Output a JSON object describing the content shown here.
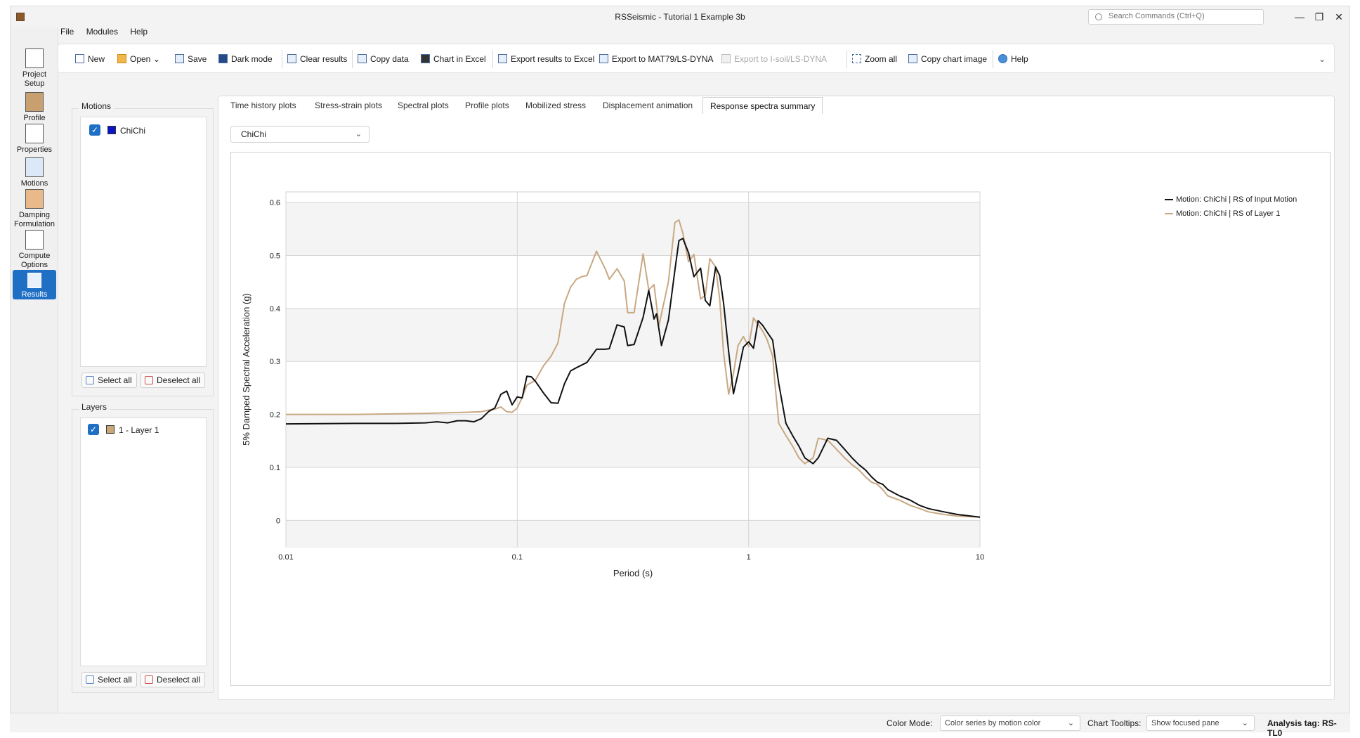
{
  "window": {
    "title": "RSSeismic - Tutorial 1 Example 3b",
    "search_placeholder": "Search Commands (Ctrl+Q)"
  },
  "menu": [
    "File",
    "Modules",
    "Help"
  ],
  "rail": [
    {
      "label": "Project Setup",
      "icon": "project-setup-icon"
    },
    {
      "label": "Profile",
      "icon": "profile-icon"
    },
    {
      "label": "Properties",
      "icon": "properties-icon"
    },
    {
      "label": "Motions",
      "icon": "motions-icon"
    },
    {
      "label": "Damping Formulation",
      "icon": "damping-icon"
    },
    {
      "label": "Compute Options",
      "icon": "compute-icon"
    },
    {
      "label": "Results",
      "icon": "results-icon",
      "active": true
    }
  ],
  "toolbar": {
    "new": "New",
    "open": "Open",
    "save": "Save",
    "dark_mode": "Dark mode",
    "clear_results": "Clear results",
    "copy_data": "Copy data",
    "chart_in_excel": "Chart in Excel",
    "export_results_excel": "Export results to Excel",
    "export_mat79": "Export to MAT79/LS-DYNA",
    "export_isoil": "Export to I-soil/LS-DYNA",
    "zoom_all": "Zoom all",
    "copy_chart_image": "Copy chart image",
    "help": "Help"
  },
  "motions_panel": {
    "title": "Motions",
    "items": [
      {
        "label": "ChiChi",
        "color": "#0a14c8",
        "checked": true
      }
    ],
    "select_all": "Select all",
    "deselect_all": "Deselect all"
  },
  "layers_panel": {
    "title": "Layers",
    "items": [
      {
        "label": "1 - Layer 1",
        "color": "#c8a878",
        "checked": true
      }
    ],
    "select_all": "Select all",
    "deselect_all": "Deselect all"
  },
  "tabs": [
    "Time history plots",
    "Stress-strain plots",
    "Spectral plots",
    "Profile plots",
    "Mobilized stress",
    "Displacement animation",
    "Response spectra summary"
  ],
  "active_tab": "Response spectra summary",
  "motion_select": "ChiChi",
  "chart_data": {
    "type": "line",
    "xlabel": "Period (s)",
    "ylabel": "5% Damped Spectral Acceleration (g)",
    "x_scale": "log",
    "xlim": [
      0.01,
      10
    ],
    "ylim": [
      -0.05,
      0.62
    ],
    "x_ticks": [
      "0.01",
      "0.1",
      "1",
      "10"
    ],
    "y_ticks": [
      "0",
      "0.1",
      "0.2",
      "0.3",
      "0.4",
      "0.5",
      "0.6"
    ],
    "legend_position": "right",
    "series": [
      {
        "name": "Motion: ChiChi | RS of Input Motion",
        "color": "#111111",
        "x": [
          0.01,
          0.02,
          0.03,
          0.04,
          0.045,
          0.05,
          0.055,
          0.06,
          0.065,
          0.07,
          0.075,
          0.08,
          0.085,
          0.09,
          0.095,
          0.1,
          0.105,
          0.11,
          0.115,
          0.12,
          0.13,
          0.14,
          0.15,
          0.16,
          0.17,
          0.18,
          0.2,
          0.22,
          0.24,
          0.25,
          0.27,
          0.29,
          0.3,
          0.32,
          0.35,
          0.37,
          0.39,
          0.4,
          0.42,
          0.45,
          0.48,
          0.5,
          0.52,
          0.55,
          0.58,
          0.62,
          0.65,
          0.68,
          0.72,
          0.75,
          0.78,
          0.82,
          0.86,
          0.9,
          0.95,
          1.0,
          1.05,
          1.1,
          1.15,
          1.2,
          1.27,
          1.3,
          1.35,
          1.45,
          1.55,
          1.65,
          1.75,
          1.9,
          2.0,
          2.2,
          2.4,
          2.6,
          2.8,
          3.0,
          3.2,
          3.4,
          3.6,
          3.8,
          4.0,
          4.5,
          5.0,
          5.5,
          6.0,
          7.0,
          8.0,
          10.0
        ],
        "y": [
          0.182,
          0.183,
          0.183,
          0.184,
          0.186,
          0.184,
          0.188,
          0.188,
          0.186,
          0.192,
          0.205,
          0.212,
          0.238,
          0.244,
          0.218,
          0.233,
          0.231,
          0.272,
          0.271,
          0.262,
          0.24,
          0.222,
          0.221,
          0.258,
          0.282,
          0.288,
          0.298,
          0.323,
          0.323,
          0.324,
          0.369,
          0.365,
          0.33,
          0.332,
          0.383,
          0.434,
          0.38,
          0.39,
          0.33,
          0.378,
          0.472,
          0.528,
          0.532,
          0.505,
          0.46,
          0.476,
          0.415,
          0.405,
          0.478,
          0.462,
          0.409,
          0.318,
          0.239,
          0.277,
          0.327,
          0.337,
          0.325,
          0.377,
          0.368,
          0.356,
          0.34,
          0.308,
          0.258,
          0.183,
          0.16,
          0.14,
          0.118,
          0.107,
          0.118,
          0.155,
          0.151,
          0.134,
          0.118,
          0.105,
          0.095,
          0.082,
          0.072,
          0.068,
          0.058,
          0.046,
          0.038,
          0.028,
          0.022,
          0.016,
          0.011,
          0.006
        ]
      },
      {
        "name": "Motion: ChiChi | RS of Layer 1",
        "color": "#c8a882",
        "x": [
          0.01,
          0.02,
          0.03,
          0.04,
          0.05,
          0.06,
          0.07,
          0.075,
          0.08,
          0.085,
          0.09,
          0.095,
          0.1,
          0.105,
          0.11,
          0.12,
          0.13,
          0.14,
          0.15,
          0.16,
          0.17,
          0.18,
          0.19,
          0.2,
          0.22,
          0.24,
          0.25,
          0.27,
          0.29,
          0.3,
          0.32,
          0.35,
          0.37,
          0.39,
          0.41,
          0.45,
          0.48,
          0.5,
          0.52,
          0.55,
          0.58,
          0.62,
          0.65,
          0.68,
          0.72,
          0.75,
          0.78,
          0.82,
          0.86,
          0.9,
          0.95,
          1.0,
          1.05,
          1.1,
          1.15,
          1.2,
          1.27,
          1.3,
          1.35,
          1.45,
          1.55,
          1.65,
          1.75,
          1.9,
          2.0,
          2.2,
          2.4,
          2.6,
          2.8,
          3.0,
          3.2,
          3.4,
          3.6,
          3.8,
          4.0,
          4.5,
          5.0,
          5.5,
          6.0,
          7.0,
          8.0,
          10.0
        ],
        "y": [
          0.2,
          0.2,
          0.201,
          0.202,
          0.203,
          0.204,
          0.205,
          0.208,
          0.21,
          0.214,
          0.205,
          0.204,
          0.212,
          0.232,
          0.255,
          0.265,
          0.292,
          0.31,
          0.335,
          0.41,
          0.44,
          0.455,
          0.46,
          0.462,
          0.508,
          0.475,
          0.455,
          0.475,
          0.452,
          0.392,
          0.392,
          0.503,
          0.435,
          0.445,
          0.368,
          0.45,
          0.562,
          0.567,
          0.542,
          0.488,
          0.502,
          0.418,
          0.425,
          0.494,
          0.478,
          0.418,
          0.315,
          0.238,
          0.277,
          0.33,
          0.347,
          0.328,
          0.382,
          0.37,
          0.357,
          0.342,
          0.31,
          0.258,
          0.183,
          0.16,
          0.14,
          0.118,
          0.107,
          0.118,
          0.155,
          0.151,
          0.134,
          0.118,
          0.105,
          0.095,
          0.082,
          0.072,
          0.068,
          0.058,
          0.046,
          0.038,
          0.028,
          0.022,
          0.016,
          0.011,
          0.008,
          0.006
        ]
      }
    ]
  },
  "status": {
    "color_mode_label": "Color Mode:",
    "color_mode_value": "Color series by motion color",
    "tooltips_label": "Chart Tooltips:",
    "tooltips_value": "Show focused pane",
    "analysis_tag": "Analysis tag: RS-TL0"
  }
}
